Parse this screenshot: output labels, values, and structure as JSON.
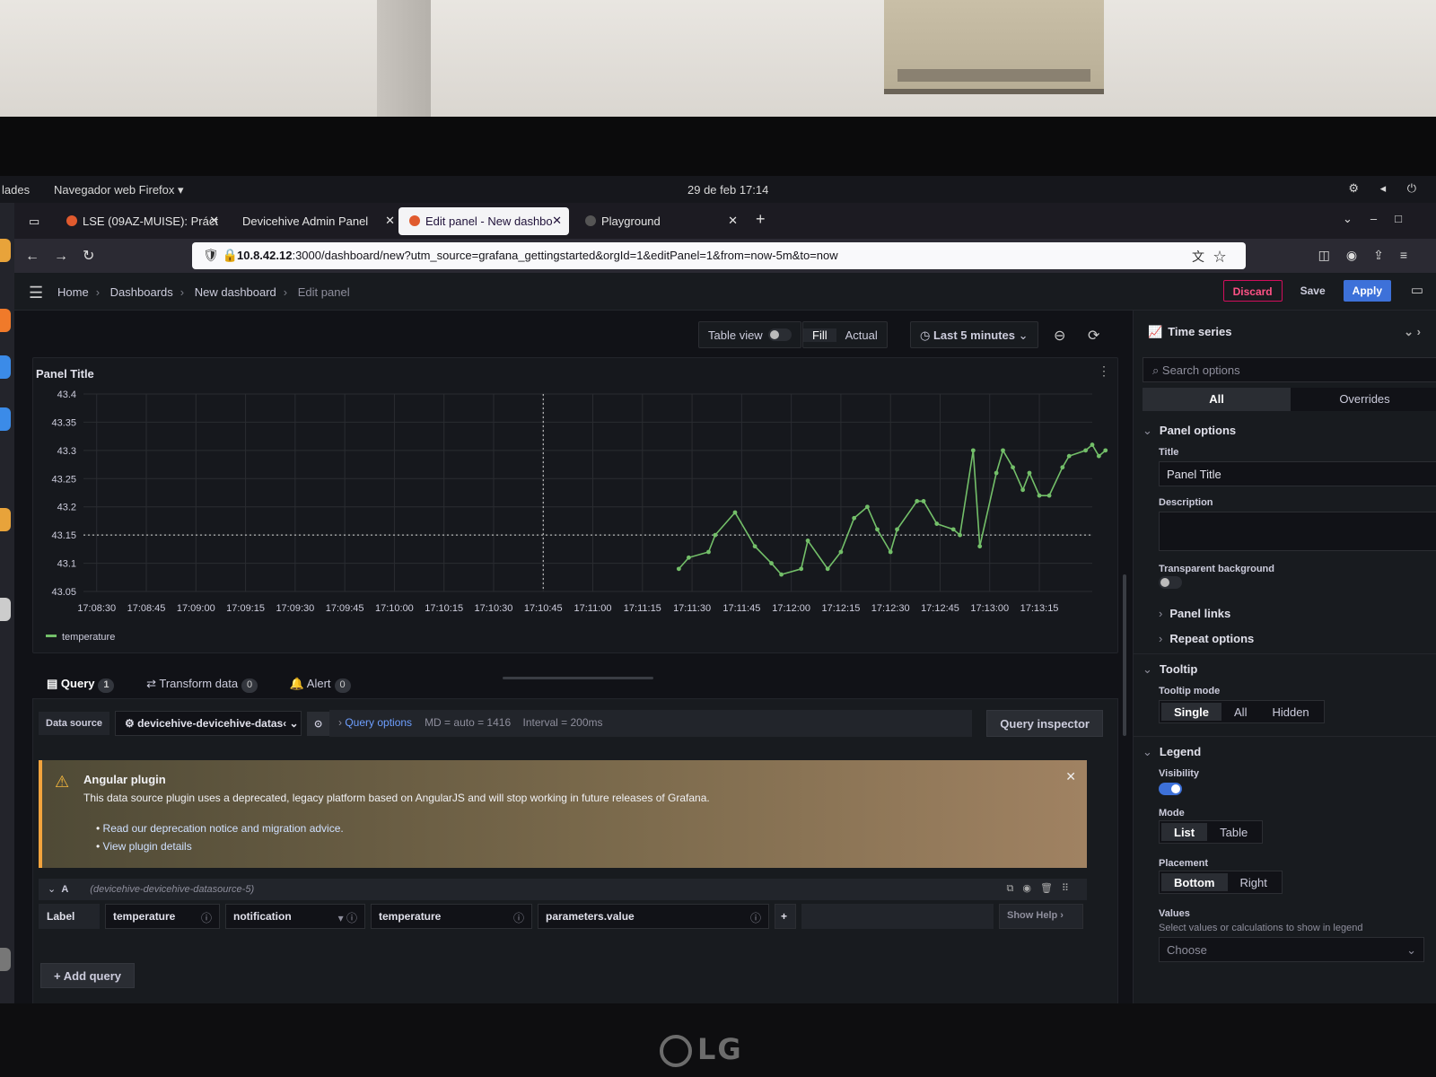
{
  "gnome": {
    "activities": "lades",
    "app": "Navegador web Firefox ▾",
    "clock": "29 de feb  17:14"
  },
  "browser": {
    "tabs": [
      {
        "label": "LSE (09AZ-MUISE): Práct"
      },
      {
        "label": "Devicehive Admin Panel"
      },
      {
        "label": "Edit panel - New dashbo"
      },
      {
        "label": "Playground"
      }
    ],
    "url_host": "10.8.42.12",
    "url_rest": ":3000/dashboard/new?utm_source=grafana_gettingstarted&orgId=1&editPanel=1&from=now-5m&to=now"
  },
  "grafana": {
    "breadcrumbs": [
      "Home",
      "Dashboards",
      "New dashboard",
      "Edit panel"
    ],
    "discard": "Discard",
    "save": "Save",
    "apply": "Apply",
    "toolbar": {
      "table_view": "Table view",
      "fill": "Fill",
      "actual": "Actual",
      "time_range": "Last 5 minutes"
    },
    "panel": {
      "title": "Panel Title"
    },
    "query_tabs": [
      {
        "label": "Query",
        "count": "1"
      },
      {
        "label": "Transform data",
        "count": "0"
      },
      {
        "label": "Alert",
        "count": "0"
      }
    ],
    "datasource": {
      "label": "Data source",
      "value": "devicehive-devicehive-datas‹"
    },
    "query_options": {
      "label": "Query options",
      "md": "MD = auto = 1416",
      "interval": "Interval = 200ms"
    },
    "query_inspector": "Query inspector",
    "alert": {
      "title": "Angular plugin",
      "body": "This data source plugin uses a deprecated, legacy platform based on AngularJS and will stop working in future releases of Grafana.",
      "links": [
        "Read our deprecation notice and migration advice.",
        "View plugin details"
      ]
    },
    "query": {
      "ref": "A",
      "source": "(devicehive-devicehive-datasource-5)",
      "label_tag": "Label",
      "label_value": "temperature",
      "type": "notification",
      "name": "temperature",
      "path": "parameters.value",
      "show_help": "Show Help"
    },
    "add_query": "Add query",
    "options": {
      "viz": "Time series",
      "search_placeholder": "Search options",
      "tab_all": "All",
      "tab_overrides": "Overrides",
      "panel_options": "Panel options",
      "title_label": "Title",
      "title_value": "Panel Title",
      "description_label": "Description",
      "transparent_label": "Transparent background",
      "panel_links": "Panel links",
      "repeat_options": "Repeat options",
      "tooltip": "Tooltip",
      "tooltip_mode": "Tooltip mode",
      "tooltip_modes": [
        "Single",
        "All",
        "Hidden"
      ],
      "legend": "Legend",
      "visibility": "Visibility",
      "mode": "Mode",
      "modes": [
        "List",
        "Table"
      ],
      "placement": "Placement",
      "placements": [
        "Bottom",
        "Right"
      ],
      "values": "Values",
      "values_hint": "Select values or calculations to show in legend",
      "choose": "Choose"
    }
  },
  "chart_data": {
    "type": "line",
    "title": "Panel Title",
    "x_ticks": [
      "17:08:30",
      "17:08:45",
      "17:09:00",
      "17:09:15",
      "17:09:30",
      "17:09:45",
      "17:10:00",
      "17:10:15",
      "17:10:30",
      "17:10:45",
      "17:11:00",
      "17:11:15",
      "17:11:30",
      "17:11:45",
      "17:12:00",
      "17:12:15",
      "17:12:30",
      "17:12:45",
      "17:13:00",
      "17:13:15"
    ],
    "y_ticks": [
      "43.05",
      "43.1",
      "43.15",
      "43.2",
      "43.25",
      "43.3",
      "43.35",
      "43.4"
    ],
    "ylim": [
      43.05,
      43.4
    ],
    "xlim_seconds": [
      0,
      305
    ],
    "series": [
      {
        "name": "temperature",
        "color": "#73bf69",
        "x_seconds": [
          180,
          183,
          189,
          191,
          197,
          203,
          208,
          211,
          217,
          219,
          225,
          229,
          233,
          237,
          240,
          244,
          246,
          252,
          254,
          258,
          263,
          265,
          269,
          271,
          276,
          278,
          281,
          284,
          286,
          289,
          292,
          296,
          298,
          303,
          305,
          307,
          309
        ],
        "y": [
          43.09,
          43.11,
          43.12,
          43.15,
          43.19,
          43.13,
          43.1,
          43.08,
          43.09,
          43.14,
          43.09,
          43.12,
          43.18,
          43.2,
          43.16,
          43.12,
          43.16,
          43.21,
          43.21,
          43.17,
          43.16,
          43.15,
          43.3,
          43.13,
          43.26,
          43.3,
          43.27,
          43.23,
          43.26,
          43.22,
          43.22,
          43.27,
          43.29,
          43.3,
          43.31,
          43.29,
          43.3
        ]
      }
    ],
    "legend": "bottom-left",
    "grid": true
  },
  "colors": {
    "accent": "#3d71d9",
    "series": "#73bf69",
    "warning": "#f2a33d",
    "discard": "#d10e5c"
  }
}
